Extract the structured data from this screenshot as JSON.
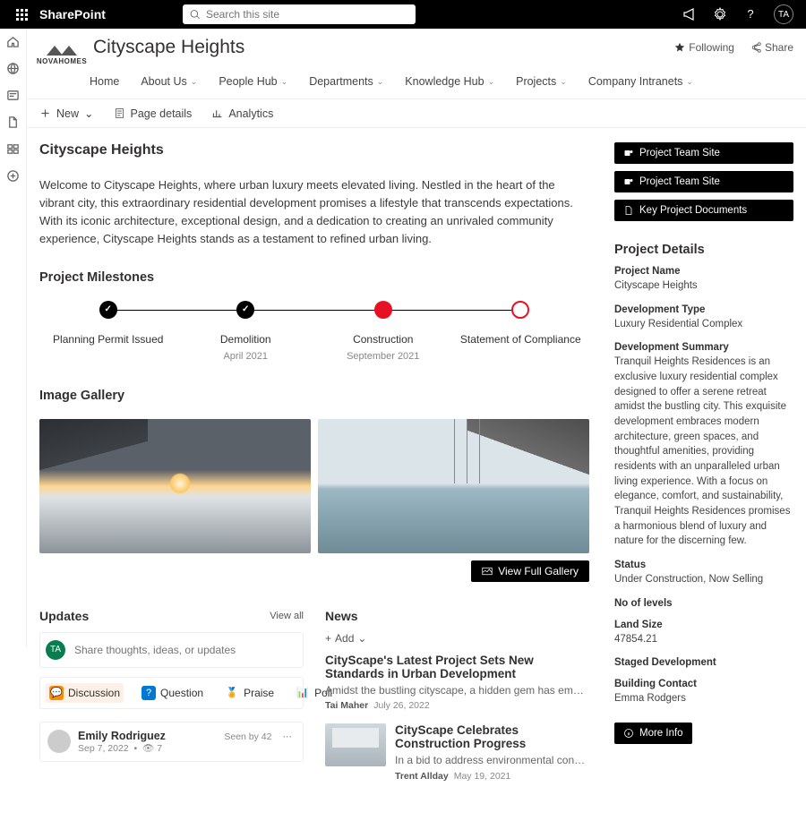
{
  "topbar": {
    "brand": "SharePoint",
    "search_placeholder": "Search this site",
    "avatar_initials": "TA"
  },
  "site": {
    "logo_text": "NOVAHOMES",
    "title": "Cityscape Heights",
    "following": "Following",
    "share": "Share",
    "nav": [
      {
        "label": "Home",
        "dropdown": false
      },
      {
        "label": "About Us",
        "dropdown": true
      },
      {
        "label": "People Hub",
        "dropdown": true
      },
      {
        "label": "Departments",
        "dropdown": true
      },
      {
        "label": "Knowledge Hub",
        "dropdown": true
      },
      {
        "label": "Projects",
        "dropdown": true
      },
      {
        "label": "Company Intranets",
        "dropdown": true
      }
    ]
  },
  "cmdbar": {
    "new": "New",
    "page_details": "Page details",
    "analytics": "Analytics"
  },
  "page": {
    "title": "Cityscape Heights",
    "intro": "Welcome to Cityscape Heights, where urban luxury meets elevated living. Nestled in the heart of the vibrant city, this extraordinary residential development promises a lifestyle that transcends expectations. With its iconic architecture, exceptional design, and a dedication to creating an unrivaled community experience, Cityscape Heights stands as a testament to refined urban living."
  },
  "milestones": {
    "heading": "Project Milestones",
    "items": [
      {
        "label": "Planning Permit Issued",
        "date": "",
        "state": "done"
      },
      {
        "label": "Demolition",
        "date": "April 2021",
        "state": "done"
      },
      {
        "label": "Construction",
        "date": "September 2021",
        "state": "active"
      },
      {
        "label": "Statement of Compliance",
        "date": "",
        "state": "future"
      }
    ]
  },
  "gallery": {
    "heading": "Image Gallery",
    "button": "View Full Gallery"
  },
  "updates": {
    "heading": "Updates",
    "view_all": "View all",
    "avatar_initials": "TA",
    "placeholder": "Share thoughts, ideas, or updates",
    "pills": [
      "Discussion",
      "Question",
      "Praise",
      "Poll"
    ],
    "post": {
      "author": "Emily Rodriguez",
      "date": "Sep 7, 2022",
      "views_icon": "👁",
      "views": "7",
      "seen_by": "Seen by 42"
    }
  },
  "news": {
    "heading": "News",
    "add": "Add",
    "items": [
      {
        "title": "CityScape's Latest Project Sets New Standards in Urban Development",
        "snippet": "Amidst the bustling cityscape, a hidden gem has emerged—a culinary wonderland that…",
        "author": "Tai Maher",
        "date": "July 26, 2022"
      },
      {
        "title": "CityScape Celebrates Construction Progress",
        "snippet": "In a bid to address environmental concerns, a leading automotive…",
        "author": "Trent Allday",
        "date": "May 19, 2021"
      }
    ]
  },
  "rail_buttons": {
    "team_site_1": "Project Team Site",
    "team_site_2": "Project Team Site",
    "key_docs": "Key Project Documents",
    "more_info": "More Info"
  },
  "details": {
    "heading": "Project Details",
    "fields": [
      {
        "label": "Project Name",
        "value": "Cityscape Heights"
      },
      {
        "label": "Development Type",
        "value": "Luxury Residential Complex"
      },
      {
        "label": "Development Summary",
        "value": "Tranquil Heights Residences is an exclusive luxury residential complex designed to offer a serene retreat amidst the bustling city. This exquisite development embraces modern architecture, green spaces, and thoughtful amenities, providing residents with an unparalleled urban living experience. With a focus on elegance, comfort, and sustainability, Tranquil Heights Residences promises a harmonious blend of luxury and nature for the discerning few."
      },
      {
        "label": "Status",
        "value": "Under Construction, Now Selling"
      },
      {
        "label": "No of levels",
        "value": ""
      },
      {
        "label": "Land Size",
        "value": "47854.21"
      },
      {
        "label": "Staged Development",
        "value": ""
      },
      {
        "label": "Building Contact",
        "value": "Emma Rodgers"
      }
    ]
  }
}
